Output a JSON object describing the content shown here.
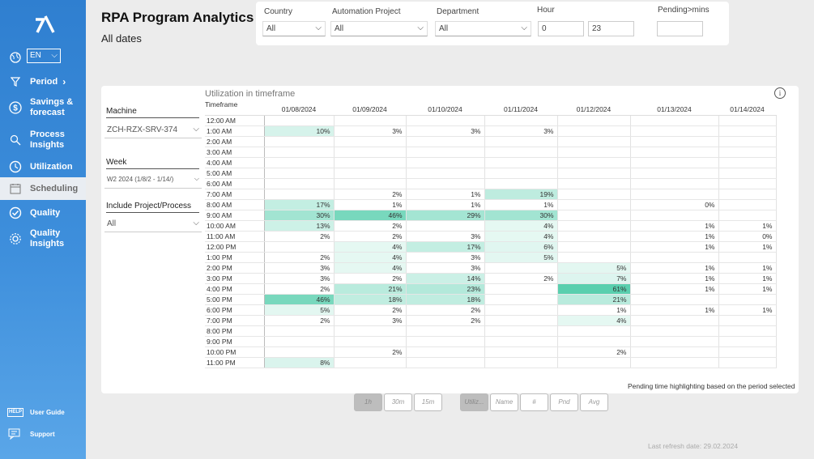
{
  "sidebar": {
    "language": "EN",
    "items": [
      {
        "label": "Period",
        "icon": "filter-icon"
      },
      {
        "label": "Savings & forecast",
        "icon": "dollar-icon"
      },
      {
        "label": "Process Insights",
        "icon": "search-icon"
      },
      {
        "label": "Utilization",
        "icon": "clock-icon"
      },
      {
        "label": "Scheduling",
        "icon": "calendar-icon"
      },
      {
        "label": "Quality",
        "icon": "check-icon"
      },
      {
        "label": "Quality Insights",
        "icon": "gear-icon"
      }
    ],
    "active_item": "Scheduling",
    "footer": [
      {
        "label": "User Guide",
        "icon": "help-icon",
        "icon_text": "HELP"
      },
      {
        "label": "Support",
        "icon": "chat-icon"
      }
    ]
  },
  "header": {
    "title": "RPA Program Analytics",
    "subtitle": "All dates"
  },
  "filters": {
    "country": {
      "label": "Country",
      "value": "All"
    },
    "project": {
      "label": "Automation Project",
      "value": "All"
    },
    "department": {
      "label": "Department",
      "value": "All"
    },
    "hour": {
      "label": "Hour",
      "from": "0",
      "to": "23"
    },
    "pending": {
      "label": "Pending>mins",
      "value": ""
    }
  },
  "slicers": {
    "machine": {
      "label": "Machine",
      "value": "ZCH-RZX-SRV-374"
    },
    "week": {
      "label": "Week",
      "value": "W2 2024 (1/8/2 - 1/14/)"
    },
    "include": {
      "label": "Include Project/Process",
      "value": "All"
    }
  },
  "grid": {
    "title": "Utilization in timeframe",
    "corner": "Timeframe",
    "dates": [
      "01/08/2024",
      "01/09/2024",
      "01/10/2024",
      "01/11/2024",
      "01/12/2024",
      "01/13/2024",
      "01/14/2024"
    ],
    "rows": [
      {
        "time": "12:00 AM",
        "cells": [
          "",
          "",
          "",
          "",
          "",
          "",
          ""
        ]
      },
      {
        "time": "1:00 AM",
        "cells": [
          "10%",
          "3%",
          "3%",
          "3%",
          "",
          "",
          ""
        ]
      },
      {
        "time": "2:00 AM",
        "cells": [
          "",
          "",
          "",
          "",
          "",
          "",
          ""
        ]
      },
      {
        "time": "3:00 AM",
        "cells": [
          "",
          "",
          "",
          "",
          "",
          "",
          ""
        ]
      },
      {
        "time": "4:00 AM",
        "cells": [
          "",
          "",
          "",
          "",
          "",
          "",
          ""
        ]
      },
      {
        "time": "5:00 AM",
        "cells": [
          "",
          "",
          "",
          "",
          "",
          "",
          ""
        ]
      },
      {
        "time": "6:00 AM",
        "cells": [
          "",
          "",
          "",
          "",
          "",
          "",
          ""
        ]
      },
      {
        "time": "7:00 AM",
        "cells": [
          "",
          "2%",
          "1%",
          "19%",
          "",
          "",
          ""
        ]
      },
      {
        "time": "8:00 AM",
        "cells": [
          "17%",
          "1%",
          "1%",
          "1%",
          "",
          "0%",
          ""
        ]
      },
      {
        "time": "9:00 AM",
        "cells": [
          "30%",
          "46%",
          "29%",
          "30%",
          "",
          "",
          ""
        ]
      },
      {
        "time": "10:00 AM",
        "cells": [
          "13%",
          "2%",
          "",
          "4%",
          "",
          "1%",
          "1%"
        ]
      },
      {
        "time": "11:00 AM",
        "cells": [
          "2%",
          "2%",
          "3%",
          "4%",
          "",
          "1%",
          "0%"
        ]
      },
      {
        "time": "12:00 PM",
        "cells": [
          "",
          "4%",
          "17%",
          "6%",
          "",
          "1%",
          "1%"
        ]
      },
      {
        "time": "1:00 PM",
        "cells": [
          "2%",
          "4%",
          "3%",
          "5%",
          "",
          "",
          ""
        ]
      },
      {
        "time": "2:00 PM",
        "cells": [
          "3%",
          "4%",
          "3%",
          "",
          "5%",
          "1%",
          "1%"
        ]
      },
      {
        "time": "3:00 PM",
        "cells": [
          "3%",
          "2%",
          "14%",
          "2%",
          "7%",
          "1%",
          "1%"
        ]
      },
      {
        "time": "4:00 PM",
        "cells": [
          "2%",
          "21%",
          "23%",
          "",
          "61%",
          "1%",
          "1%"
        ]
      },
      {
        "time": "5:00 PM",
        "cells": [
          "46%",
          "18%",
          "18%",
          "",
          "21%",
          "",
          ""
        ]
      },
      {
        "time": "6:00 PM",
        "cells": [
          "5%",
          "2%",
          "2%",
          "",
          "1%",
          "1%",
          "1%"
        ]
      },
      {
        "time": "7:00 PM",
        "cells": [
          "2%",
          "3%",
          "2%",
          "",
          "4%",
          "",
          ""
        ]
      },
      {
        "time": "8:00 PM",
        "cells": [
          "",
          "",
          "",
          "",
          "",
          "",
          ""
        ]
      },
      {
        "time": "9:00 PM",
        "cells": [
          "",
          "",
          "",
          "",
          "",
          "",
          ""
        ]
      },
      {
        "time": "10:00 PM",
        "cells": [
          "",
          "2%",
          "",
          "",
          "2%",
          "",
          ""
        ]
      },
      {
        "time": "11:00 PM",
        "cells": [
          "8%",
          "",
          "",
          "",
          "",
          "",
          ""
        ]
      }
    ],
    "highlight_color": "#3cc7a0",
    "note": "Pending time highlighting based on the period selected"
  },
  "toggles_left": [
    {
      "label": "1h",
      "active": true
    },
    {
      "label": "30m",
      "active": false
    },
    {
      "label": "15m",
      "active": false
    }
  ],
  "toggles_right": [
    {
      "label": "Utiliz...",
      "active": true
    },
    {
      "label": "Name",
      "active": false
    },
    {
      "label": "#",
      "active": false
    },
    {
      "label": "Pnd",
      "active": false
    },
    {
      "label": "Avg",
      "active": false
    }
  ],
  "footer": {
    "refresh": "Last refresh date: 29.02.2024"
  }
}
